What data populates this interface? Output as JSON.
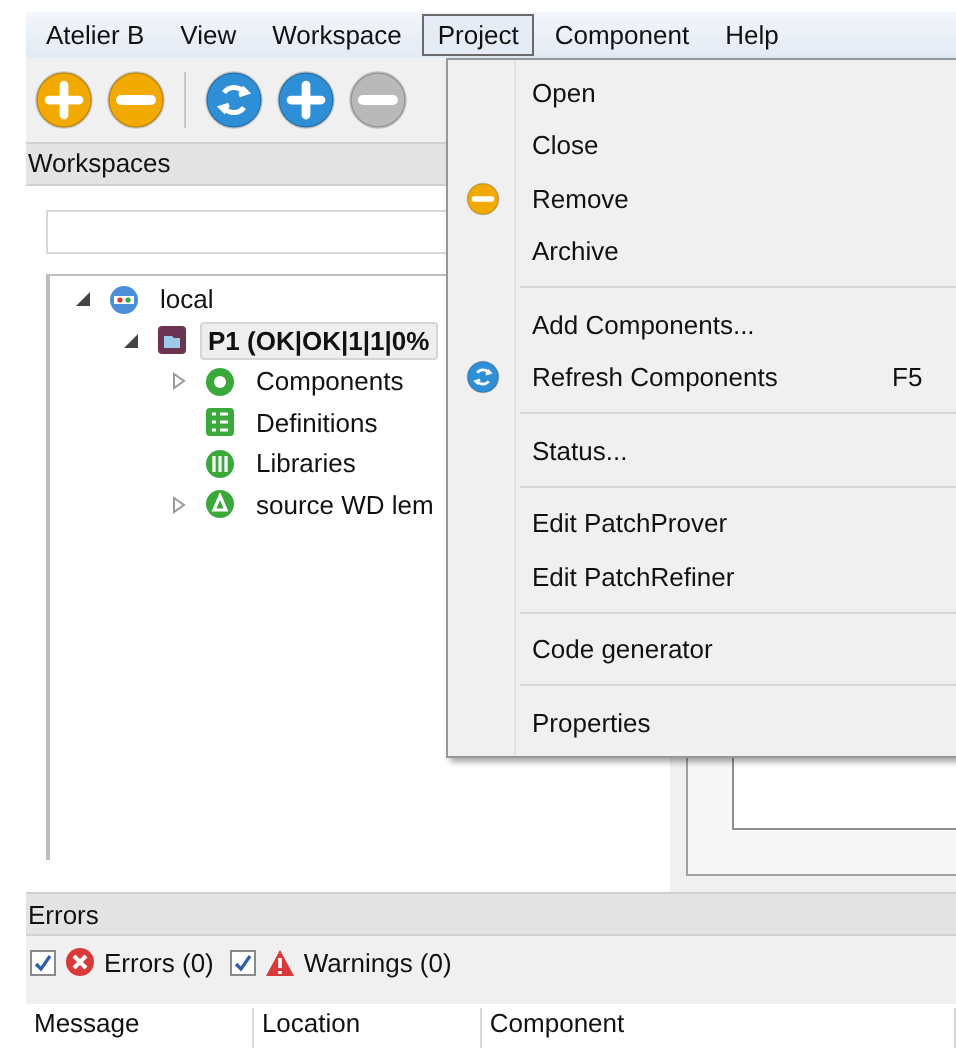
{
  "menubar": [
    {
      "label": "Atelier B",
      "selected": false
    },
    {
      "label": "View",
      "selected": false
    },
    {
      "label": "Workspace",
      "selected": false
    },
    {
      "label": "Project",
      "selected": true
    },
    {
      "label": "Component",
      "selected": false
    },
    {
      "label": "Help",
      "selected": false
    }
  ],
  "toolbar": [
    [
      {
        "kind": "plus",
        "color": "#f2a900",
        "disabled": false
      },
      {
        "kind": "minus",
        "color": "#f2a900",
        "disabled": false
      }
    ],
    [
      {
        "kind": "refresh",
        "color": "#2f8fd6",
        "disabled": false
      },
      {
        "kind": "plus",
        "color": "#2f8fd6",
        "disabled": false
      },
      {
        "kind": "minus",
        "disabled": true
      }
    ]
  ],
  "workspaces": {
    "title": "Workspaces",
    "tree": [
      {
        "label": "local",
        "kind": "workspace",
        "expanded": true,
        "selected": false,
        "children": [
          {
            "label": "P1 (OK|OK|1|1|0%",
            "kind": "project",
            "expanded": true,
            "selected": true,
            "children": [
              {
                "label": "Components",
                "kind": "components",
                "expanded": false,
                "selected": false
              },
              {
                "label": "Definitions",
                "kind": "definitions",
                "selected": false
              },
              {
                "label": "Libraries",
                "kind": "libraries",
                "selected": false
              },
              {
                "label": "source WD lem",
                "kind": "source",
                "expanded": false,
                "selected": false
              }
            ]
          }
        ]
      }
    ]
  },
  "project_menu": [
    {
      "kind": "plain",
      "label": "Open"
    },
    {
      "kind": "plain",
      "label": "Close"
    },
    {
      "kind": "minus",
      "label": "Remove"
    },
    {
      "kind": "plain",
      "label": "Archive"
    },
    {
      "kind": "separator"
    },
    {
      "kind": "plain",
      "label": "Add Components..."
    },
    {
      "kind": "refresh",
      "label": "Refresh Components",
      "shortcut": "F5"
    },
    {
      "kind": "separator"
    },
    {
      "kind": "plain",
      "label": "Status..."
    },
    {
      "kind": "separator"
    },
    {
      "kind": "plain",
      "label": "Edit PatchProver"
    },
    {
      "kind": "plain",
      "label": "Edit PatchRefiner"
    },
    {
      "kind": "separator"
    },
    {
      "kind": "plain",
      "label": "Code generator"
    },
    {
      "kind": "separator"
    },
    {
      "kind": "plain",
      "label": "Properties"
    }
  ],
  "errors": {
    "title": "Errors",
    "filters": [
      {
        "kind": "error",
        "label": "Errors (0)",
        "checked": true
      },
      {
        "kind": "warning",
        "label": "Warnings (0)",
        "checked": true
      }
    ],
    "columns": [
      "Message",
      "Location",
      "Component"
    ]
  }
}
